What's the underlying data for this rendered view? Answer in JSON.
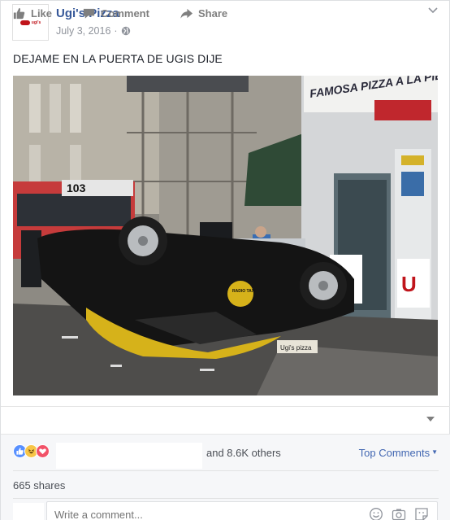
{
  "post": {
    "page_name": "Ugi's Pizza",
    "avatar_text": "ugi's",
    "date": "July 3, 2016",
    "separator": "·",
    "text": "DEJAME EN LA PUERTA DE UGIS DIJE",
    "photo_signs": {
      "store_banner": "FAMOSA PIZZA A LA PIEDRA",
      "bus_number": "103",
      "taxi_logo": "RADIO TAXI",
      "small_sign": "Ugi's pizza"
    }
  },
  "actions": {
    "like_label": "Like",
    "comment_label": "Comment",
    "share_label": "Share"
  },
  "summary": {
    "reactions": [
      "like",
      "haha",
      "love"
    ],
    "others_text": "and 8.6K others",
    "top_comments_label": "Top Comments",
    "shares_text": "665 shares"
  },
  "comment": {
    "placeholder": "Write a comment..."
  },
  "colors": {
    "link_blue": "#365899",
    "accent_blue": "#4267b2",
    "muted": "#90949c",
    "brand_red": "#c0141b"
  }
}
